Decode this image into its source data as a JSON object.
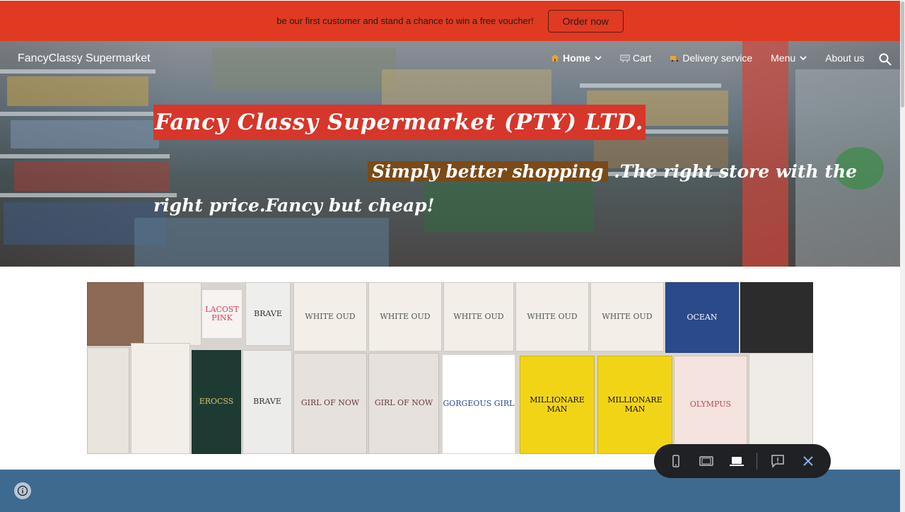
{
  "banner": {
    "text": "be our first customer and stand a chance to win a free voucher!",
    "button_label": "Order now",
    "color": "#e03a23"
  },
  "header": {
    "site_name": "FancyClassy Supermarket",
    "nav": [
      {
        "label": "Home",
        "icon": "house-icon",
        "has_dropdown": true,
        "active": true
      },
      {
        "label": "Cart",
        "icon": "cart-icon",
        "has_dropdown": false,
        "active": false
      },
      {
        "label": "Delivery service",
        "icon": "delivery-truck-icon",
        "has_dropdown": false,
        "active": false
      },
      {
        "label": "Menu",
        "icon": "",
        "has_dropdown": true,
        "active": false
      },
      {
        "label": "About us",
        "icon": "",
        "has_dropdown": false,
        "active": false
      }
    ],
    "search_icon": "search-icon"
  },
  "hero": {
    "title": "Fancy Classy Supermarket (PTY) LTD.",
    "tagline_highlight": "Simply better shopping",
    "tagline_rest": " .The right store with the",
    "tagline_line2": "right price.Fancy but cheap!",
    "title_bg": "#d7362a"
  },
  "products": {
    "row1": [
      "",
      "LACOST PINK",
      "BRAVE",
      "WHITE OUD",
      "WHITE OUD",
      "WHITE OUD",
      "WHITE OUD",
      "WHITE OUD",
      "OCEAN",
      ""
    ],
    "row2": [
      "",
      "EROCSS",
      "BRAVE",
      "GIRL OF NOW",
      "GIRL OF NOW",
      "GORGEOUS GIRL",
      "MILLIONARE MAN",
      "MILLIONARE MAN",
      "OLYMPUS",
      ""
    ]
  },
  "footer": {
    "color": "#3f6a8f"
  },
  "preview_toolbar": {
    "buttons": [
      "phone-icon",
      "tablet-icon",
      "laptop-icon",
      "feedback-icon",
      "close-icon"
    ]
  }
}
